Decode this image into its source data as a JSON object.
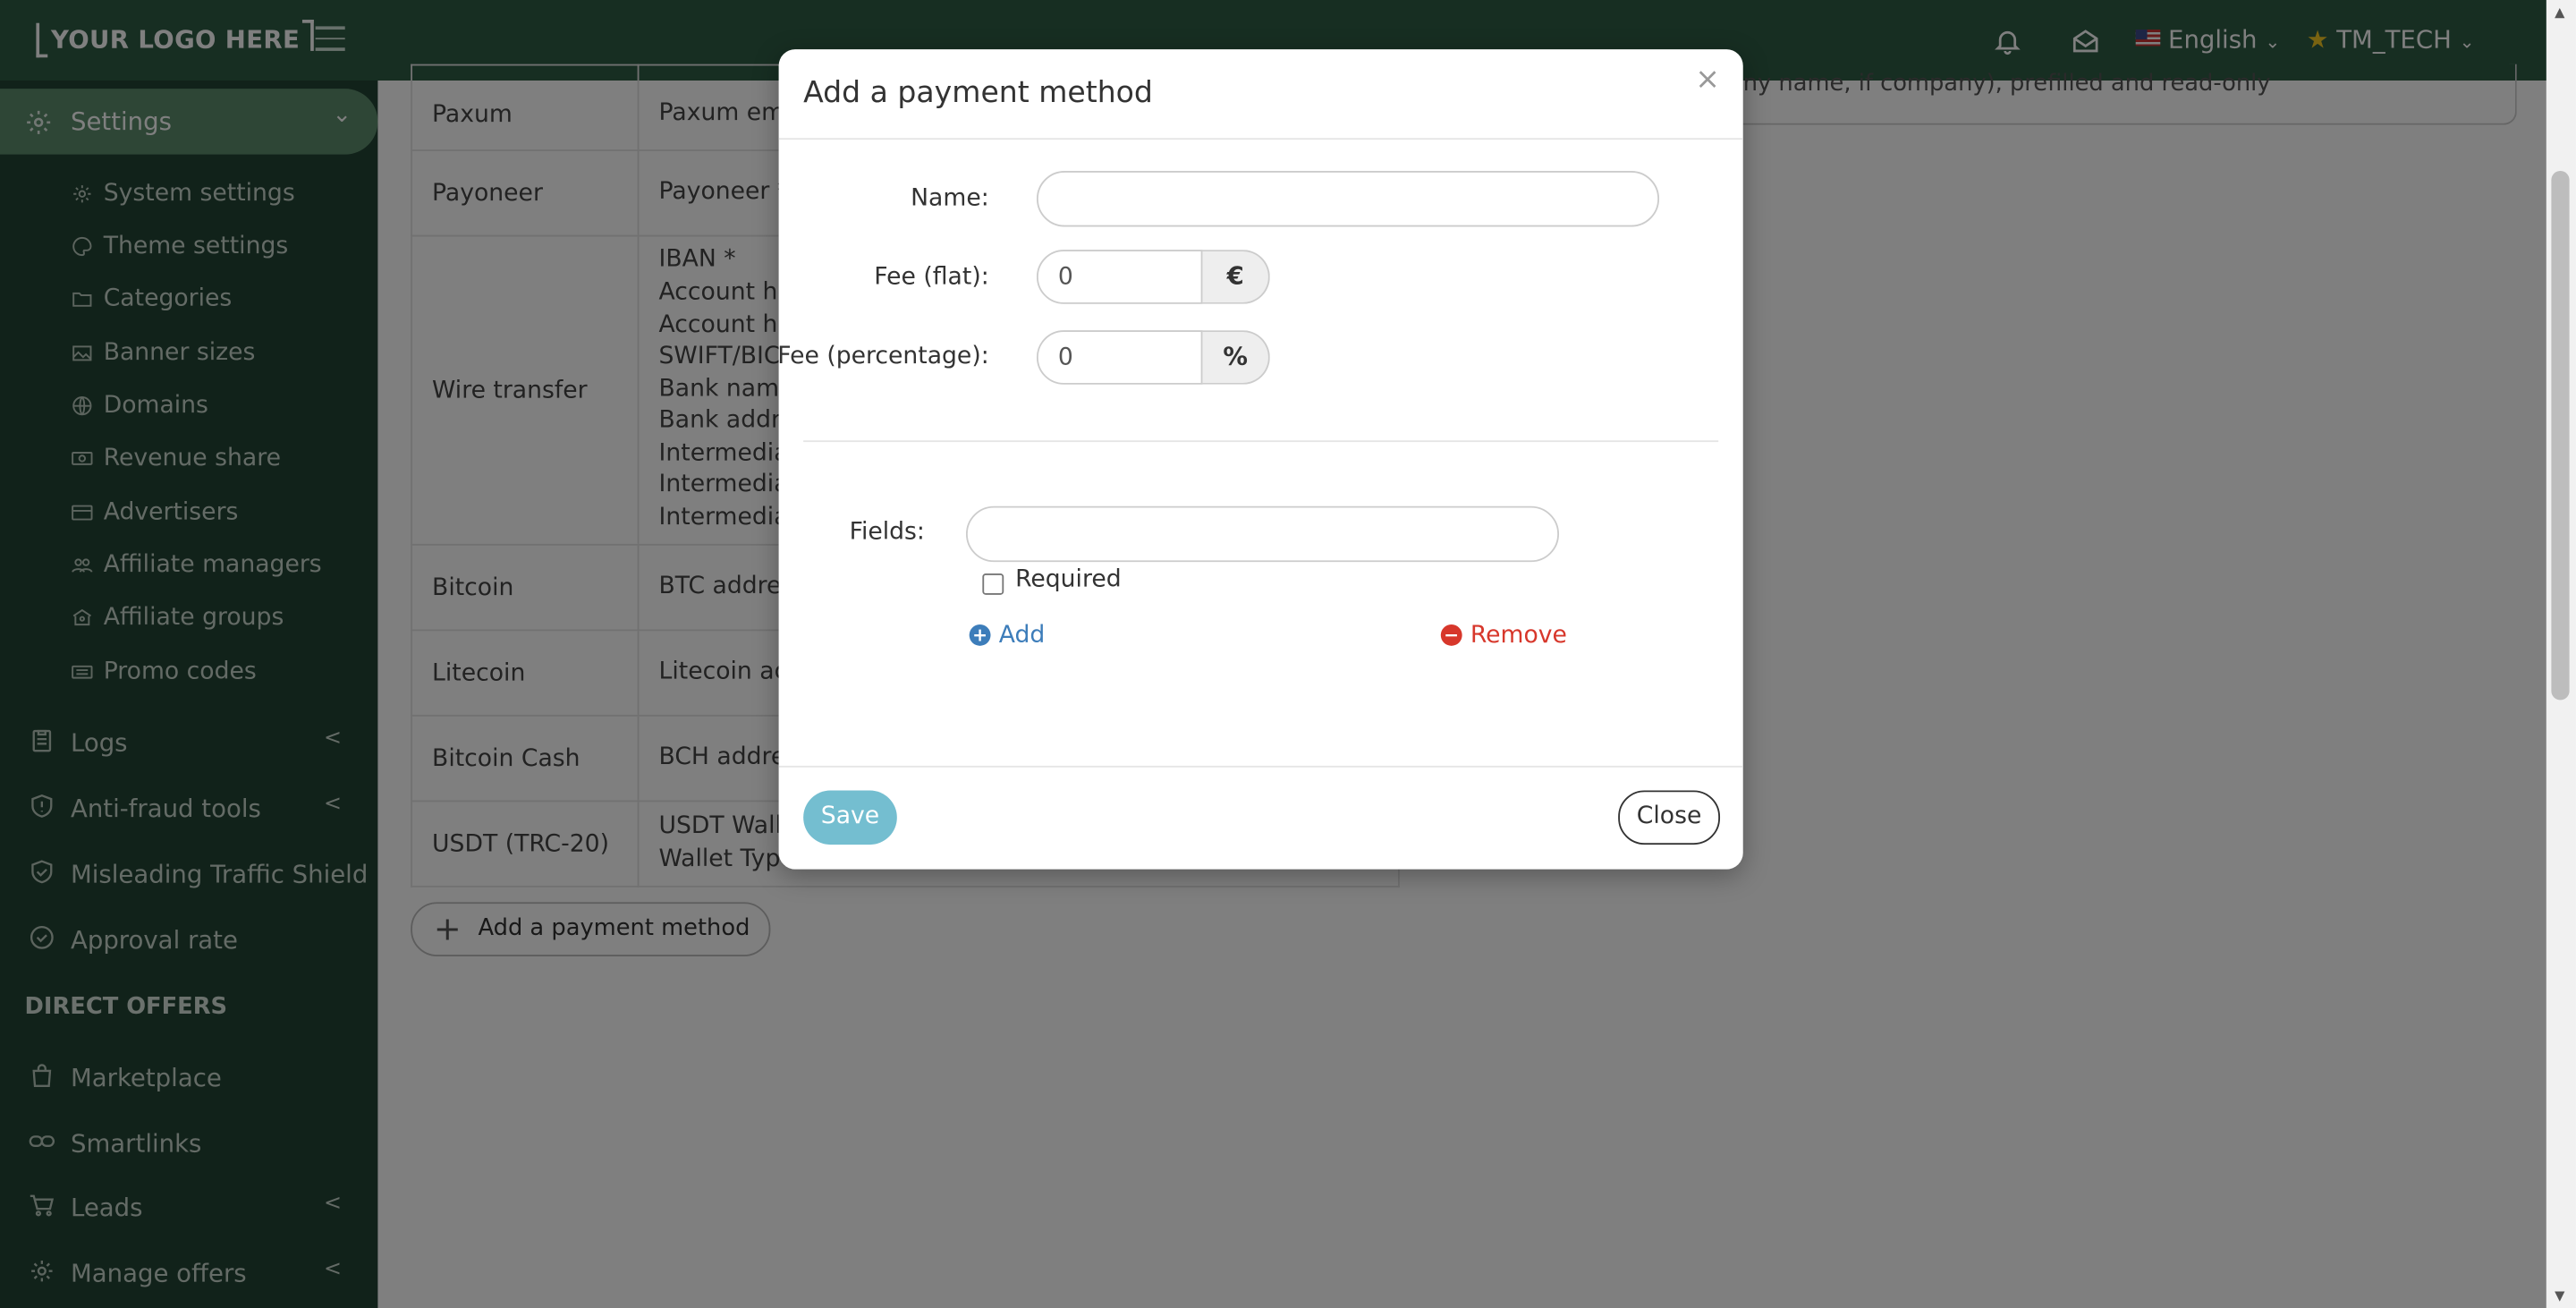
{
  "topbar": {
    "logo": "YOUR LOGO HERE",
    "language": "English",
    "user": "TM_TECH"
  },
  "sidebar": {
    "active": "Settings",
    "settings_items": [
      {
        "label": "System settings",
        "icon": "gear-icon"
      },
      {
        "label": "Theme settings",
        "icon": "palette-icon"
      },
      {
        "label": "Categories",
        "icon": "folder-icon"
      },
      {
        "label": "Banner sizes",
        "icon": "image-icon"
      },
      {
        "label": "Domains",
        "icon": "globe-icon"
      },
      {
        "label": "Revenue share",
        "icon": "money-icon"
      },
      {
        "label": "Advertisers",
        "icon": "card-icon"
      },
      {
        "label": "Affiliate managers",
        "icon": "users-icon"
      },
      {
        "label": "Affiliate groups",
        "icon": "group-icon"
      },
      {
        "label": "Promo codes",
        "icon": "ticket-icon"
      }
    ],
    "main_items": [
      {
        "label": "Logs",
        "icon": "clipboard-icon"
      },
      {
        "label": "Anti-fraud tools",
        "icon": "shield-icon"
      },
      {
        "label": "Misleading Traffic Shield",
        "icon": "shield-check-icon"
      },
      {
        "label": "Approval rate",
        "icon": "check-circle-icon"
      }
    ],
    "section_header": "DIRECT OFFERS",
    "offer_items": [
      {
        "label": "Marketplace",
        "icon": "bag-icon"
      },
      {
        "label": "Smartlinks",
        "icon": "link-icon"
      },
      {
        "label": "Leads",
        "icon": "cart-icon"
      },
      {
        "label": "Manage offers",
        "icon": "gear-icon"
      }
    ]
  },
  "table": {
    "rows": [
      {
        "method": "Paxum",
        "fields": [
          "Paxum email"
        ]
      },
      {
        "method": "Payoneer",
        "fields": [
          "Payoneer *"
        ]
      },
      {
        "method": "Wire transfer",
        "fields": [
          "IBAN *",
          "Account hold",
          "Account hold",
          "SWIFT/BIC *",
          "Bank name *",
          "Bank address",
          "Intermediary",
          "Intermediary",
          "Intermediary"
        ]
      },
      {
        "method": "Bitcoin",
        "fields": [
          "BTC address"
        ]
      },
      {
        "method": "Litecoin",
        "fields": [
          "Litecoin addr"
        ]
      },
      {
        "method": "Bitcoin Cash",
        "fields": [
          "BCH address"
        ]
      },
      {
        "method": "USDT (TRC-20)",
        "fields": [
          "USDT Wallet",
          "Wallet Type ("
        ]
      }
    ],
    "background_field_text": "ny name, if company), prefilled and read-only",
    "add_button": "Add a payment method"
  },
  "modal": {
    "title": "Add a payment method",
    "name_label": "Name:",
    "name_value": "",
    "fee_flat_label": "Fee (flat):",
    "fee_flat_value": "0",
    "fee_flat_unit": "€",
    "fee_pct_label": "Fee (percentage):",
    "fee_pct_value": "0",
    "fee_pct_unit": "%",
    "fields_label": "Fields:",
    "field_value": "",
    "required_label": "Required",
    "required_checked": false,
    "add_label": "Add",
    "remove_label": "Remove",
    "save_label": "Save",
    "close_label": "Close",
    "close_x": "×"
  },
  "colors": {
    "topbar": "#2f5c45",
    "sidebar": "#234534",
    "sidebar_active": "#5d8c6d",
    "save_button": "#74bed0",
    "link_add": "#3d7dba",
    "link_remove": "#d7372b"
  }
}
